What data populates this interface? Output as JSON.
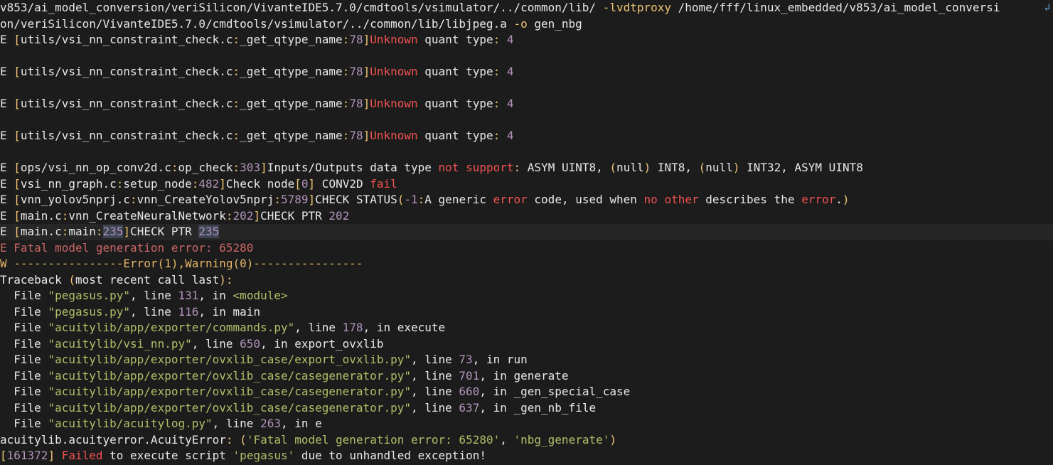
{
  "colors": {
    "background": "#1c1c1c",
    "default": "#e8e8e8",
    "bracket": "#f0c674",
    "number": "#b294bb",
    "error": "#ef5350",
    "string": "#b5bd68",
    "accent": "#cc6666",
    "warning": "#e5b567"
  },
  "wrap_icon": "line-wrap-icon",
  "lines": [
    {
      "wrapped": true,
      "segments": [
        {
          "t": "v853/ai_model_conversion/veriSilicon/VivanteIDE5.7.0/cmdtools/vsimulator/../common/lib/ ",
          "c": "default"
        },
        {
          "t": "-lvdtproxy",
          "c": "bracket"
        },
        {
          "t": " /home/fff/linux_embedded/v853/ai_model_conversi",
          "c": "default"
        }
      ]
    },
    {
      "segments": [
        {
          "t": "on/veriSilicon/VivanteIDE5.7.0/cmdtools/vsimulator/../common/lib/libjpeg.a ",
          "c": "default"
        },
        {
          "t": "-o",
          "c": "bracket"
        },
        {
          "t": " gen_nbg",
          "c": "default"
        }
      ]
    },
    {
      "segments": [
        {
          "t": "E ",
          "c": "default"
        },
        {
          "t": "[",
          "c": "bracket"
        },
        {
          "t": "utils/vsi_nn_constraint_check.c",
          "c": "default"
        },
        {
          "t": ":",
          "c": "bracket"
        },
        {
          "t": "_get_qtype_name",
          "c": "default"
        },
        {
          "t": ":",
          "c": "bracket"
        },
        {
          "t": "78",
          "c": "number"
        },
        {
          "t": "]",
          "c": "bracket"
        },
        {
          "t": "Unknown",
          "c": "error"
        },
        {
          "t": " quant type",
          "c": "default"
        },
        {
          "t": ":",
          "c": "bracket"
        },
        {
          "t": " ",
          "c": "default"
        },
        {
          "t": "4",
          "c": "number"
        }
      ]
    },
    {
      "segments": []
    },
    {
      "segments": [
        {
          "t": "E ",
          "c": "default"
        },
        {
          "t": "[",
          "c": "bracket"
        },
        {
          "t": "utils/vsi_nn_constraint_check.c",
          "c": "default"
        },
        {
          "t": ":",
          "c": "bracket"
        },
        {
          "t": "_get_qtype_name",
          "c": "default"
        },
        {
          "t": ":",
          "c": "bracket"
        },
        {
          "t": "78",
          "c": "number"
        },
        {
          "t": "]",
          "c": "bracket"
        },
        {
          "t": "Unknown",
          "c": "error"
        },
        {
          "t": " quant type",
          "c": "default"
        },
        {
          "t": ":",
          "c": "bracket"
        },
        {
          "t": " ",
          "c": "default"
        },
        {
          "t": "4",
          "c": "number"
        }
      ]
    },
    {
      "segments": []
    },
    {
      "segments": [
        {
          "t": "E ",
          "c": "default"
        },
        {
          "t": "[",
          "c": "bracket"
        },
        {
          "t": "utils/vsi_nn_constraint_check.c",
          "c": "default"
        },
        {
          "t": ":",
          "c": "bracket"
        },
        {
          "t": "_get_qtype_name",
          "c": "default"
        },
        {
          "t": ":",
          "c": "bracket"
        },
        {
          "t": "78",
          "c": "number"
        },
        {
          "t": "]",
          "c": "bracket"
        },
        {
          "t": "Unknown",
          "c": "error"
        },
        {
          "t": " quant type",
          "c": "default"
        },
        {
          "t": ":",
          "c": "bracket"
        },
        {
          "t": " ",
          "c": "default"
        },
        {
          "t": "4",
          "c": "number"
        }
      ]
    },
    {
      "segments": []
    },
    {
      "segments": [
        {
          "t": "E ",
          "c": "default"
        },
        {
          "t": "[",
          "c": "bracket"
        },
        {
          "t": "utils/vsi_nn_constraint_check.c",
          "c": "default"
        },
        {
          "t": ":",
          "c": "bracket"
        },
        {
          "t": "_get_qtype_name",
          "c": "default"
        },
        {
          "t": ":",
          "c": "bracket"
        },
        {
          "t": "78",
          "c": "number"
        },
        {
          "t": "]",
          "c": "bracket"
        },
        {
          "t": "Unknown",
          "c": "error"
        },
        {
          "t": " quant type",
          "c": "default"
        },
        {
          "t": ":",
          "c": "bracket"
        },
        {
          "t": " ",
          "c": "default"
        },
        {
          "t": "4",
          "c": "number"
        }
      ]
    },
    {
      "segments": []
    },
    {
      "segments": [
        {
          "t": "E ",
          "c": "default"
        },
        {
          "t": "[",
          "c": "bracket"
        },
        {
          "t": "ops/vsi_nn_op_conv2d.c",
          "c": "default"
        },
        {
          "t": ":",
          "c": "bracket"
        },
        {
          "t": "op_check",
          "c": "default"
        },
        {
          "t": ":",
          "c": "bracket"
        },
        {
          "t": "303",
          "c": "number"
        },
        {
          "t": "]",
          "c": "bracket"
        },
        {
          "t": "Inputs/Outputs data type ",
          "c": "default"
        },
        {
          "t": "not support",
          "c": "error"
        },
        {
          "t": ":",
          "c": "bracket"
        },
        {
          "t": " ASYM UINT8, ",
          "c": "default"
        },
        {
          "t": "(",
          "c": "bracket"
        },
        {
          "t": "null",
          "c": "default"
        },
        {
          "t": ")",
          "c": "bracket"
        },
        {
          "t": " INT8, ",
          "c": "default"
        },
        {
          "t": "(",
          "c": "bracket"
        },
        {
          "t": "null",
          "c": "default"
        },
        {
          "t": ")",
          "c": "bracket"
        },
        {
          "t": " INT32, ASYM UINT8",
          "c": "default"
        }
      ]
    },
    {
      "segments": [
        {
          "t": "E ",
          "c": "default"
        },
        {
          "t": "[",
          "c": "bracket"
        },
        {
          "t": "vsi_nn_graph.c",
          "c": "default"
        },
        {
          "t": ":",
          "c": "bracket"
        },
        {
          "t": "setup_node",
          "c": "default"
        },
        {
          "t": ":",
          "c": "bracket"
        },
        {
          "t": "482",
          "c": "number"
        },
        {
          "t": "]",
          "c": "bracket"
        },
        {
          "t": "Check node",
          "c": "default"
        },
        {
          "t": "[",
          "c": "bracket"
        },
        {
          "t": "0",
          "c": "number"
        },
        {
          "t": "]",
          "c": "bracket"
        },
        {
          "t": " CONV2D ",
          "c": "default"
        },
        {
          "t": "fail",
          "c": "error"
        }
      ]
    },
    {
      "segments": [
        {
          "t": "E ",
          "c": "default"
        },
        {
          "t": "[",
          "c": "bracket"
        },
        {
          "t": "vnn_yolov5nprj.c",
          "c": "default"
        },
        {
          "t": ":",
          "c": "bracket"
        },
        {
          "t": "vnn_CreateYolov5nprj",
          "c": "default"
        },
        {
          "t": ":",
          "c": "bracket"
        },
        {
          "t": "5789",
          "c": "number"
        },
        {
          "t": "]",
          "c": "bracket"
        },
        {
          "t": "CHECK STATUS",
          "c": "default"
        },
        {
          "t": "(",
          "c": "bracket"
        },
        {
          "t": "-1",
          "c": "number"
        },
        {
          "t": ":",
          "c": "bracket"
        },
        {
          "t": "A generic ",
          "c": "default"
        },
        {
          "t": "error",
          "c": "error"
        },
        {
          "t": " code, used when ",
          "c": "default"
        },
        {
          "t": "no other",
          "c": "error"
        },
        {
          "t": " describes the ",
          "c": "default"
        },
        {
          "t": "error",
          "c": "error"
        },
        {
          "t": ".",
          "c": "default"
        },
        {
          "t": ")",
          "c": "bracket"
        }
      ]
    },
    {
      "segments": [
        {
          "t": "E ",
          "c": "default"
        },
        {
          "t": "[",
          "c": "bracket"
        },
        {
          "t": "main.c",
          "c": "default"
        },
        {
          "t": ":",
          "c": "bracket"
        },
        {
          "t": "vnn_CreateNeuralNetwork",
          "c": "default"
        },
        {
          "t": ":",
          "c": "bracket"
        },
        {
          "t": "202",
          "c": "number"
        },
        {
          "t": "]",
          "c": "bracket"
        },
        {
          "t": "CHECK PTR ",
          "c": "default"
        },
        {
          "t": "202",
          "c": "number"
        }
      ]
    },
    {
      "highlight": true,
      "segments": [
        {
          "t": "E ",
          "c": "default"
        },
        {
          "t": "[",
          "c": "bracket"
        },
        {
          "t": "main.c",
          "c": "default"
        },
        {
          "t": ":",
          "c": "bracket"
        },
        {
          "t": "main",
          "c": "default"
        },
        {
          "t": ":",
          "c": "bracket"
        },
        {
          "t": "235",
          "c": "number",
          "sel": true
        },
        {
          "t": "]",
          "c": "bracket"
        },
        {
          "t": "CHECK PTR ",
          "c": "default"
        },
        {
          "t": "235",
          "c": "number",
          "sel": true
        }
      ]
    },
    {
      "segments": [
        {
          "t": "E Fatal model generation error: 65280",
          "c": "accent"
        }
      ]
    },
    {
      "segments": [
        {
          "t": "W ----------------Error(1),Warning(0)----------------",
          "c": "warning"
        }
      ]
    },
    {
      "segments": [
        {
          "t": "Traceback ",
          "c": "default"
        },
        {
          "t": "(",
          "c": "bracket"
        },
        {
          "t": "most recent call last",
          "c": "default"
        },
        {
          "t": ")",
          "c": "bracket"
        },
        {
          "t": ":",
          "c": "bracket"
        }
      ]
    },
    {
      "segments": [
        {
          "t": "  File ",
          "c": "default"
        },
        {
          "t": "\"pegasus.py\"",
          "c": "string"
        },
        {
          "t": ", line ",
          "c": "default"
        },
        {
          "t": "131",
          "c": "number"
        },
        {
          "t": ", in ",
          "c": "default"
        },
        {
          "t": "<module>",
          "c": "string"
        }
      ]
    },
    {
      "segments": [
        {
          "t": "  File ",
          "c": "default"
        },
        {
          "t": "\"pegasus.py\"",
          "c": "string"
        },
        {
          "t": ", line ",
          "c": "default"
        },
        {
          "t": "116",
          "c": "number"
        },
        {
          "t": ", in main",
          "c": "default"
        }
      ]
    },
    {
      "segments": [
        {
          "t": "  File ",
          "c": "default"
        },
        {
          "t": "\"acuitylib/app/exporter/commands.py\"",
          "c": "string"
        },
        {
          "t": ", line ",
          "c": "default"
        },
        {
          "t": "178",
          "c": "number"
        },
        {
          "t": ", in execute",
          "c": "default"
        }
      ]
    },
    {
      "segments": [
        {
          "t": "  File ",
          "c": "default"
        },
        {
          "t": "\"acuitylib/vsi_nn.py\"",
          "c": "string"
        },
        {
          "t": ", line ",
          "c": "default"
        },
        {
          "t": "650",
          "c": "number"
        },
        {
          "t": ", in export_ovxlib",
          "c": "default"
        }
      ]
    },
    {
      "segments": [
        {
          "t": "  File ",
          "c": "default"
        },
        {
          "t": "\"acuitylib/app/exporter/ovxlib_case/export_ovxlib.py\"",
          "c": "string"
        },
        {
          "t": ", line ",
          "c": "default"
        },
        {
          "t": "73",
          "c": "number"
        },
        {
          "t": ", in run",
          "c": "default"
        }
      ]
    },
    {
      "segments": [
        {
          "t": "  File ",
          "c": "default"
        },
        {
          "t": "\"acuitylib/app/exporter/ovxlib_case/casegenerator.py\"",
          "c": "string"
        },
        {
          "t": ", line ",
          "c": "default"
        },
        {
          "t": "701",
          "c": "number"
        },
        {
          "t": ", in generate",
          "c": "default"
        }
      ]
    },
    {
      "segments": [
        {
          "t": "  File ",
          "c": "default"
        },
        {
          "t": "\"acuitylib/app/exporter/ovxlib_case/casegenerator.py\"",
          "c": "string"
        },
        {
          "t": ", line ",
          "c": "default"
        },
        {
          "t": "660",
          "c": "number"
        },
        {
          "t": ", in _gen_special_case",
          "c": "default"
        }
      ]
    },
    {
      "segments": [
        {
          "t": "  File ",
          "c": "default"
        },
        {
          "t": "\"acuitylib/app/exporter/ovxlib_case/casegenerator.py\"",
          "c": "string"
        },
        {
          "t": ", line ",
          "c": "default"
        },
        {
          "t": "637",
          "c": "number"
        },
        {
          "t": ", in _gen_nb_file",
          "c": "default"
        }
      ]
    },
    {
      "segments": [
        {
          "t": "  File ",
          "c": "default"
        },
        {
          "t": "\"acuitylib/acuitylog.py\"",
          "c": "string"
        },
        {
          "t": ", line ",
          "c": "default"
        },
        {
          "t": "263",
          "c": "number"
        },
        {
          "t": ", in e",
          "c": "default"
        }
      ]
    },
    {
      "segments": [
        {
          "t": "acuitylib.acuityerror.AcuityError",
          "c": "default"
        },
        {
          "t": ":",
          "c": "bracket"
        },
        {
          "t": " ",
          "c": "default"
        },
        {
          "t": "(",
          "c": "bracket"
        },
        {
          "t": "'Fatal model generation error: 65280'",
          "c": "string"
        },
        {
          "t": ", ",
          "c": "default"
        },
        {
          "t": "'nbg_generate'",
          "c": "string"
        },
        {
          "t": ")",
          "c": "bracket"
        }
      ]
    },
    {
      "segments": [
        {
          "t": "[",
          "c": "bracket"
        },
        {
          "t": "161372",
          "c": "number"
        },
        {
          "t": "]",
          "c": "bracket"
        },
        {
          "t": " ",
          "c": "default"
        },
        {
          "t": "Failed",
          "c": "error"
        },
        {
          "t": " to execute script ",
          "c": "default"
        },
        {
          "t": "'pegasus'",
          "c": "string"
        },
        {
          "t": " due to unhandled exception!",
          "c": "default"
        }
      ]
    }
  ]
}
